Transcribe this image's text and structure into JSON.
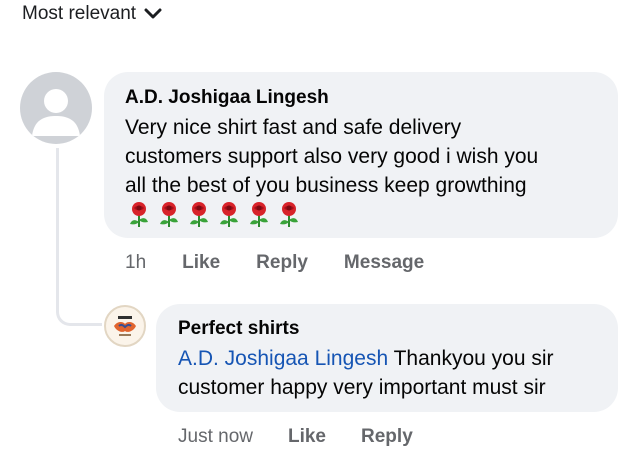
{
  "sort": {
    "label": "Most relevant",
    "icon": "chevron-down-icon"
  },
  "comments": [
    {
      "author": "A.D. Joshigaa Lingesh",
      "text_lines": [
        "Very nice  shirt fast and safe delivery",
        "customers support also very good i wish you",
        "all the best of you business keep growthing"
      ],
      "emojis": [
        "🌹",
        "🌹",
        "🌹",
        "🌹",
        "🌹",
        "🌹"
      ],
      "time": "1h",
      "actions": {
        "like": "Like",
        "reply": "Reply",
        "message": "Message"
      }
    }
  ],
  "reply": {
    "author": "Perfect shirts",
    "mention": "A.D. Joshigaa Lingesh",
    "text_first": " Thankyou you sir",
    "text_second": "customer happy very important must sir",
    "time": "Just now",
    "actions": {
      "like": "Like",
      "reply": "Reply"
    }
  },
  "colors": {
    "bubble": "#f0f2f5",
    "mention": "#1655b4",
    "meta": "#65676b",
    "avatar_placeholder": "#cfd2d7"
  }
}
